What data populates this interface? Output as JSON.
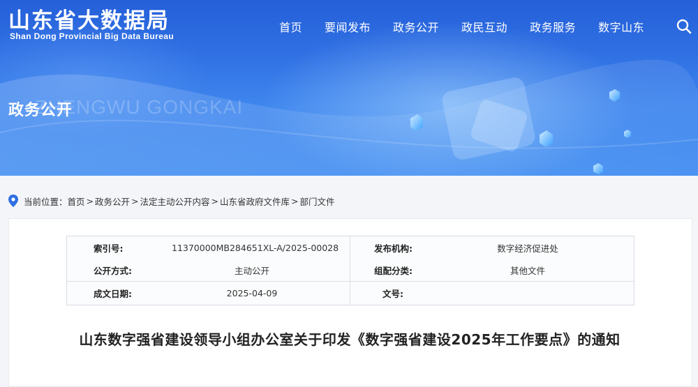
{
  "header": {
    "logo_cn": "山东省大数据局",
    "logo_en": "Shan Dong Provincial Big Data Bureau",
    "nav": [
      {
        "label": "首页"
      },
      {
        "label": "要闻发布"
      },
      {
        "label": "政务公开"
      },
      {
        "label": "政民互动"
      },
      {
        "label": "政务服务"
      },
      {
        "label": "数字山东"
      }
    ],
    "search_icon": "search-icon"
  },
  "banner": {
    "section_title": "政务公开",
    "watermark": "ZHENGWU GONGKAI"
  },
  "breadcrumb": {
    "prefix": "当前位置：",
    "items": [
      "首页",
      "政务公开",
      "法定主动公开内容",
      "山东省政府文件库",
      "部门文件"
    ],
    "separator": ">"
  },
  "meta": {
    "index_label": "索引号:",
    "index_value": "11370000MB284651XL-A/2025-00028",
    "org_label": "发布机构:",
    "org_value": "数字经济促进处",
    "mode_label": "公开方式:",
    "mode_value": "主动公开",
    "category_label": "组配分类:",
    "category_value": "其他文件",
    "date_label": "成文日期:",
    "date_value": "2025-04-09",
    "docno_label": "文号:",
    "docno_value": ""
  },
  "document": {
    "title": "山东数字强省建设领导小组办公室关于印发《数字强省建设2025年工作要点》的通知"
  },
  "colors": {
    "banner_top": "#2560d9",
    "banner_bottom": "#4b93f2",
    "text_dark": "#222222",
    "page_bg": "#f3f5f8"
  }
}
